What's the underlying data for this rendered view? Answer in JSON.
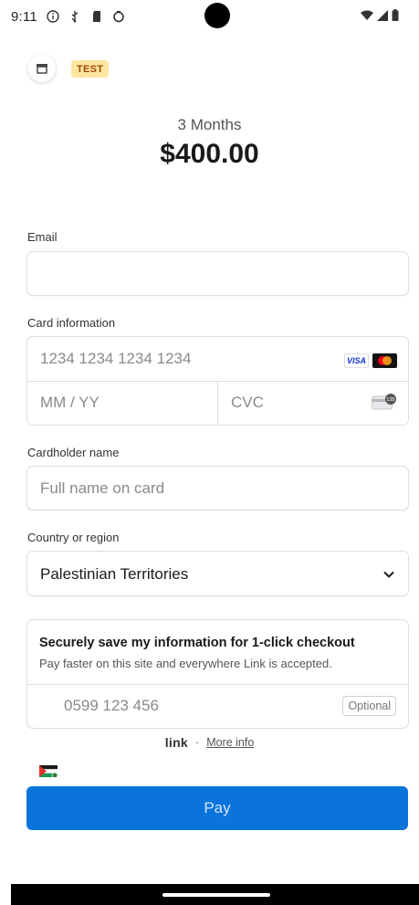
{
  "status_bar": {
    "time": "9:11",
    "icons": [
      "info-icon",
      "usb-icon",
      "sd-card-icon",
      "sync-icon"
    ],
    "right_icons": [
      "wifi-icon",
      "signal-icon",
      "battery-icon"
    ]
  },
  "header": {
    "badge": "TEST",
    "product_name": "3 Months",
    "price": "$400.00"
  },
  "form": {
    "email": {
      "label": "Email",
      "value": ""
    },
    "card": {
      "label": "Card information",
      "number_placeholder": "1234 1234 1234 1234",
      "expiry_placeholder": "MM / YY",
      "cvc_placeholder": "CVC",
      "brands": [
        "VISA",
        "mastercard-icon"
      ],
      "cvc_icon_text": "135"
    },
    "cardholder": {
      "label": "Cardholder name",
      "placeholder": "Full name on card"
    },
    "country": {
      "label": "Country or region",
      "value": "Palestinian Territories"
    }
  },
  "link": {
    "title": "Securely save my information for 1-click checkout",
    "subtitle": "Pay faster on this site and everywhere Link is accepted.",
    "phone_placeholder": "0599 123 456",
    "optional": "Optional",
    "footer_logo": "link",
    "separator": "·",
    "more_info": "More info"
  },
  "pay_button": {
    "label": "Pay"
  },
  "colors": {
    "accent": "#0a74da",
    "badge_bg": "#fde6a0",
    "badge_text": "#a04a00"
  }
}
